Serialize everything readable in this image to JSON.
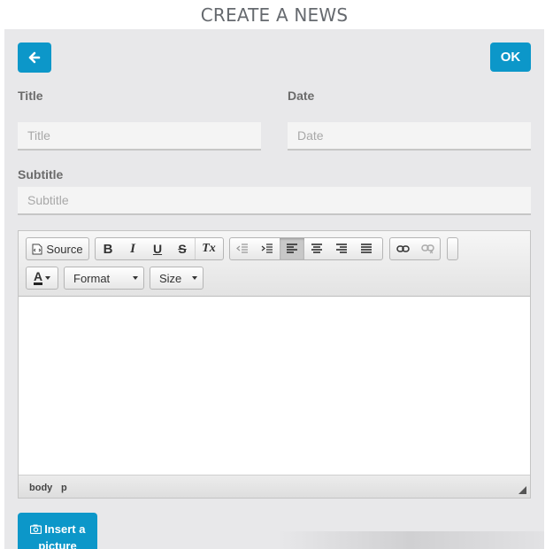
{
  "header": {
    "title": "CREATE A NEWS"
  },
  "actions": {
    "back_icon": "arrow-left-icon",
    "ok_label": "OK"
  },
  "form": {
    "title_label": "Title",
    "title_placeholder": "Title",
    "date_label": "Date",
    "date_placeholder": "Date",
    "subtitle_label": "Subtitle",
    "subtitle_placeholder": "Subtitle"
  },
  "editor": {
    "toolbar": {
      "source_label": "Source",
      "bold_label": "B",
      "italic_label": "I",
      "underline_label": "U",
      "strike_label": "S",
      "clear_format_label": "Tx",
      "text_color_label": "A",
      "format_label": "Format",
      "size_label": "Size",
      "icons": [
        "source-icon",
        "bold-icon",
        "italic-icon",
        "underline-icon",
        "strikethrough-icon",
        "remove-format-icon",
        "outdent-icon",
        "indent-icon",
        "align-left-icon",
        "align-center-icon",
        "align-right-icon",
        "justify-icon",
        "link-icon",
        "unlink-icon",
        "text-color-icon"
      ]
    },
    "status": {
      "path_body": "body",
      "path_p": "p"
    }
  },
  "insert_picture": {
    "label_line1": "Insert a",
    "label_line2": "picture",
    "icon": "camera-icon"
  },
  "colors": {
    "accent": "#0c97c9",
    "panel": "#e8e8ea"
  }
}
